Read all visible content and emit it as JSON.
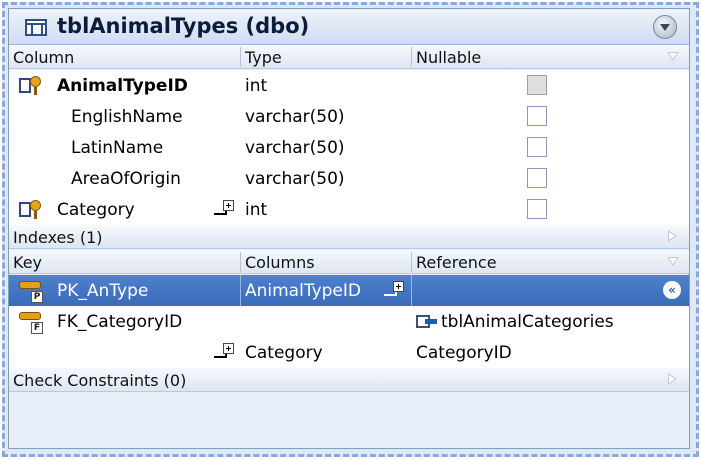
{
  "table": {
    "title": "tblAnimalTypes (dbo)",
    "icons": {
      "table": "table-icon",
      "collapse": "collapse-up-icon"
    }
  },
  "columns_header": {
    "column": "Column",
    "type": "Type",
    "nullable": "Nullable"
  },
  "columns": [
    {
      "name": "AnimalTypeID",
      "type": "int",
      "bold": true,
      "key_icon": "primary-key-column-icon",
      "nullable_disabled": true
    },
    {
      "name": "EnglishName",
      "type": "varchar(50)"
    },
    {
      "name": "LatinName",
      "type": "varchar(50)"
    },
    {
      "name": "AreaOfOrigin",
      "type": "varchar(50)"
    },
    {
      "name": "Category",
      "type": "int",
      "key_icon": "foreign-key-column-icon",
      "expand_icon": "expand-relation-icon"
    }
  ],
  "indexes": {
    "label": "Indexes (1)"
  },
  "keys_header": {
    "key": "Key",
    "columns": "Columns",
    "reference": "Reference"
  },
  "keys": [
    {
      "name": "PK_AnType",
      "badge": "P",
      "columns": "AnimalTypeID",
      "selected": true,
      "reference": ""
    },
    {
      "name": "FK_CategoryID",
      "badge": "F",
      "columns": "",
      "reference": "tblAnimalCategories"
    },
    {
      "name": "",
      "columns": "Category",
      "reference": "CategoryID"
    }
  ],
  "check_constraints": {
    "label": "Check Constraints (0)"
  },
  "colors": {
    "selection": "#3a6bb9",
    "panel": "#e9eff8",
    "border": "#7f9db9"
  }
}
